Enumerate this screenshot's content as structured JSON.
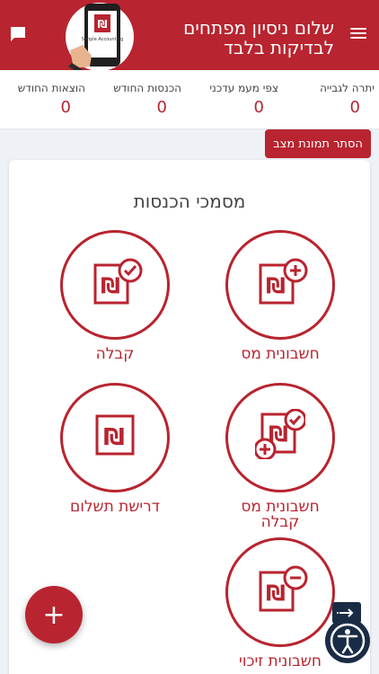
{
  "header": {
    "title": "שלום ניסיון מפתחים לבדיקות בלבד",
    "logo_text": "Simple Accounting"
  },
  "stats": [
    {
      "label": "יתרה לגבייה",
      "value": "0"
    },
    {
      "label": "צפי מעמ עדכני",
      "value": "0"
    },
    {
      "label": "הכנסות החודש",
      "value": "0"
    },
    {
      "label": "הוצאות החודש",
      "value": "0"
    }
  ],
  "hide_button": "הסתר תמונת מצב",
  "section_title": "מסמכי הכנסות",
  "documents": [
    {
      "label": "חשבונית מס",
      "icon": "invoice-plus-icon"
    },
    {
      "label": "קבלה",
      "icon": "receipt-check-icon"
    },
    {
      "label": "חשבונית מס קבלה",
      "icon": "invoice-receipt-icon"
    },
    {
      "label": "דרישת תשלום",
      "icon": "payment-request-icon"
    },
    {
      "label": "חשבונית זיכוי",
      "icon": "credit-invoice-icon"
    }
  ],
  "fab_label": "+",
  "colors": {
    "accent": "#b8242f",
    "dark": "#1a2c45"
  }
}
